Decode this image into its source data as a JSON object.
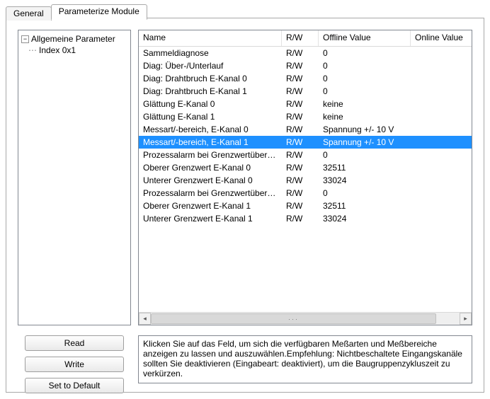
{
  "tabs": {
    "general": "General",
    "parameterize": "Parameterize Module"
  },
  "tree": {
    "root": "Allgemeine Parameter",
    "child": "Index 0x1"
  },
  "columns": {
    "name": "Name",
    "rw": "R/W",
    "offline": "Offline Value",
    "online": "Online Value"
  },
  "rows": [
    {
      "name": "Sammeldiagnose",
      "rw": "R/W",
      "offline": "0"
    },
    {
      "name": "Diag: Über-/Unterlauf",
      "rw": "R/W",
      "offline": "0"
    },
    {
      "name": "Diag: Drahtbruch E-Kanal 0",
      "rw": "R/W",
      "offline": "0"
    },
    {
      "name": "Diag: Drahtbruch E-Kanal 1",
      "rw": "R/W",
      "offline": "0"
    },
    {
      "name": "Glättung E-Kanal 0",
      "rw": "R/W",
      "offline": "keine"
    },
    {
      "name": "Glättung E-Kanal 1",
      "rw": "R/W",
      "offline": "keine"
    },
    {
      "name": "Messart/-bereich, E-Kanal 0",
      "rw": "R/W",
      "offline": "Spannung +/- 10 V"
    },
    {
      "name": "Messart/-bereich, E-Kanal 1",
      "rw": "R/W",
      "offline": "Spannung +/- 10 V"
    },
    {
      "name": "Prozessalarm bei Grenzwertüberschre...",
      "rw": "R/W",
      "offline": "0"
    },
    {
      "name": "Oberer Grenzwert E-Kanal 0",
      "rw": "R/W",
      "offline": "32511"
    },
    {
      "name": "Unterer Grenzwert E-Kanal 0",
      "rw": "R/W",
      "offline": "33024"
    },
    {
      "name": "Prozessalarm bei Grenzwertüberschre...",
      "rw": "R/W",
      "offline": "0"
    },
    {
      "name": "Oberer Grenzwert E-Kanal 1",
      "rw": "R/W",
      "offline": "32511"
    },
    {
      "name": "Unterer Grenzwert E-Kanal 1",
      "rw": "R/W",
      "offline": "33024"
    }
  ],
  "selected_index": 7,
  "buttons": {
    "read": "Read",
    "write": "Write",
    "default": "Set to Default"
  },
  "description": "Klicken Sie auf das Feld, um sich die verfügbaren Meßarten und Meßbereiche anzeigen zu lassen und auszuwählen.Empfehlung: Nichtbeschaltete Eingangskanäle sollten Sie deaktivieren (Eingabeart: deaktiviert), um die Baugruppenzykluszeit zu verkürzen."
}
